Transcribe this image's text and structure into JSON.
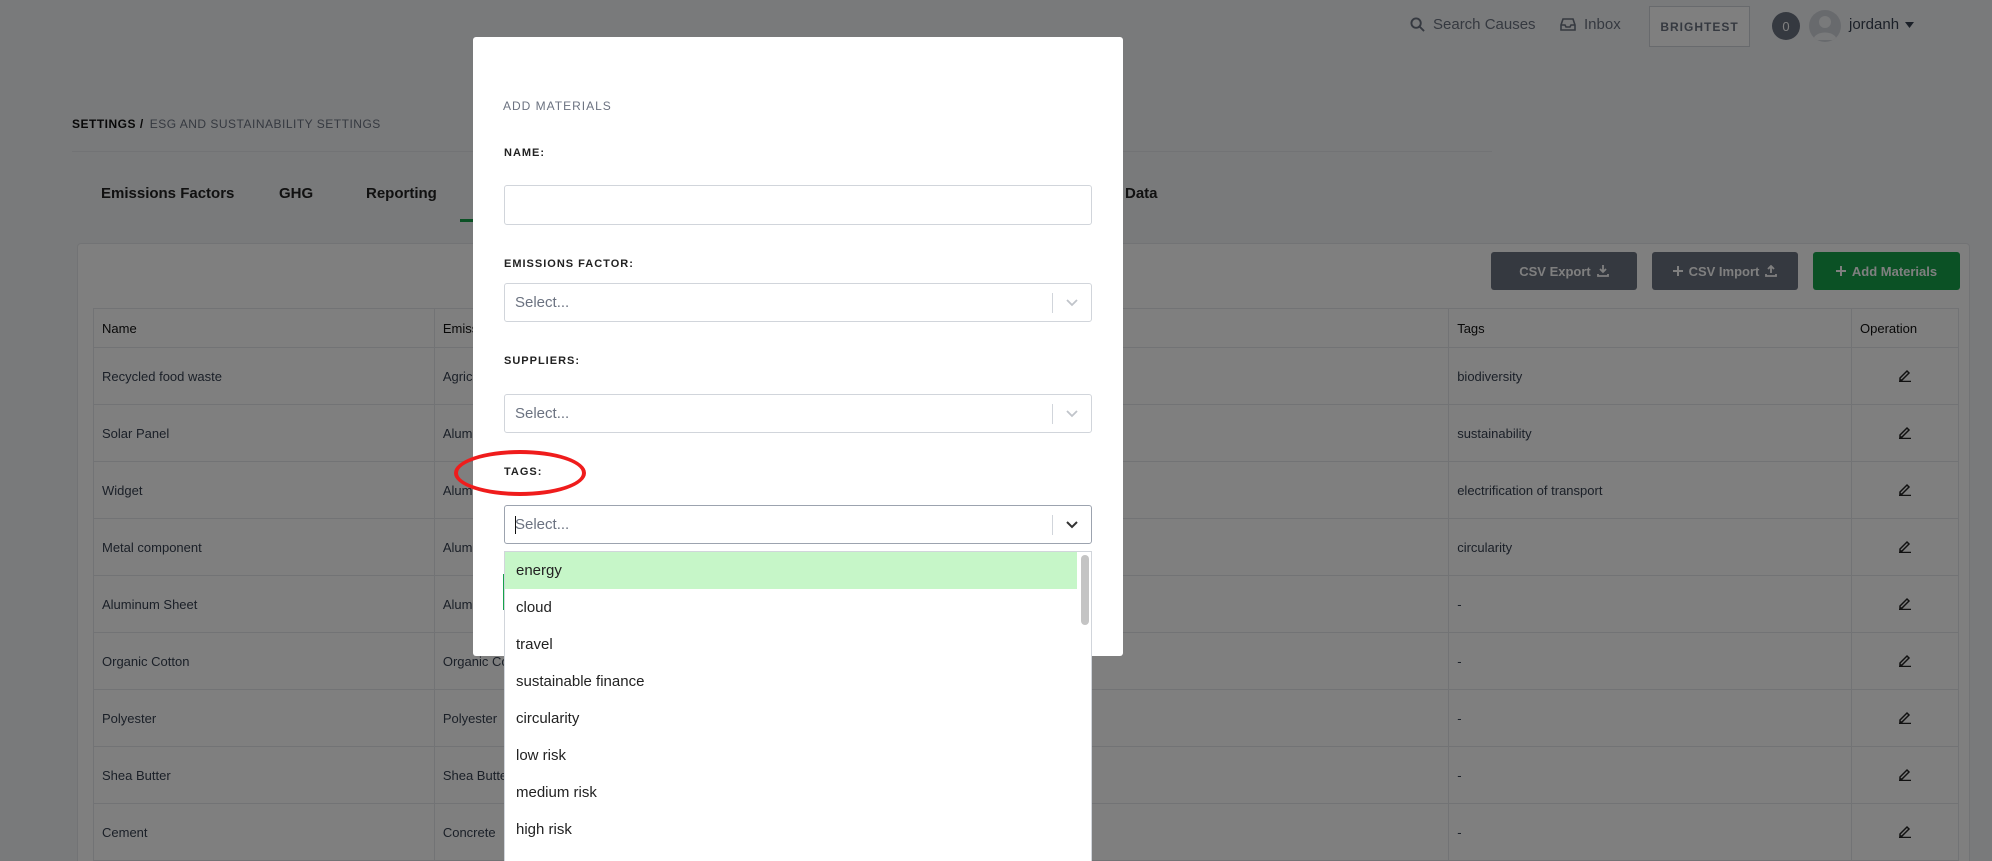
{
  "topbar": {
    "search_label": "Search Causes",
    "inbox_label": "Inbox",
    "brand_button": "BRIGHTEST",
    "notification_count": "0",
    "username": "jordanh"
  },
  "breadcrumb": {
    "root": "SETTINGS /",
    "current": "ESG AND SUSTAINABILITY SETTINGS"
  },
  "tabs": [
    "Emissions Factors",
    "GHG",
    "Reporting",
    "Data"
  ],
  "toolbar": {
    "csv_export": "CSV Export",
    "csv_import": "CSV Import",
    "add_materials": "Add Materials",
    "colors": {
      "gray": "#6b7280",
      "green": "#16a34a"
    }
  },
  "table": {
    "headers": [
      "Name",
      "Emiss",
      "",
      "Tags",
      "Operation"
    ],
    "rows": [
      {
        "name": "Recycled food waste",
        "ef": "Agricu",
        "tags": "biodiversity"
      },
      {
        "name": "Solar Panel",
        "ef": "Alumi",
        "tags": "sustainability"
      },
      {
        "name": "Widget",
        "ef": "Alumi",
        "tags": "electrification of transport"
      },
      {
        "name": "Metal component",
        "ef": "Alumi",
        "tags": "circularity"
      },
      {
        "name": "Aluminum Sheet",
        "ef": "Alumi",
        "tags": "-"
      },
      {
        "name": "Organic Cotton",
        "ef": "Organic Co",
        "tags": "-"
      },
      {
        "name": "Polyester",
        "ef": "Polyester",
        "tags": "-"
      },
      {
        "name": "Shea Butter",
        "ef": "Shea Butter",
        "tags": "-"
      },
      {
        "name": "Cement",
        "ef": "Concrete",
        "tags": "-"
      }
    ]
  },
  "modal": {
    "title": "ADD MATERIALS",
    "name_label": "NAME:",
    "emissions_factor_label": "EMISSIONS FACTOR:",
    "suppliers_label": "SUPPLIERS:",
    "tags_label": "TAGS:",
    "select_placeholder": "Select..."
  },
  "tag_options": [
    "energy",
    "cloud",
    "travel",
    "sustainable finance",
    "circularity",
    "low risk",
    "medium risk",
    "high risk"
  ],
  "highlight_color": "#c6f6c8",
  "annotation_color": "#ef1c1c"
}
